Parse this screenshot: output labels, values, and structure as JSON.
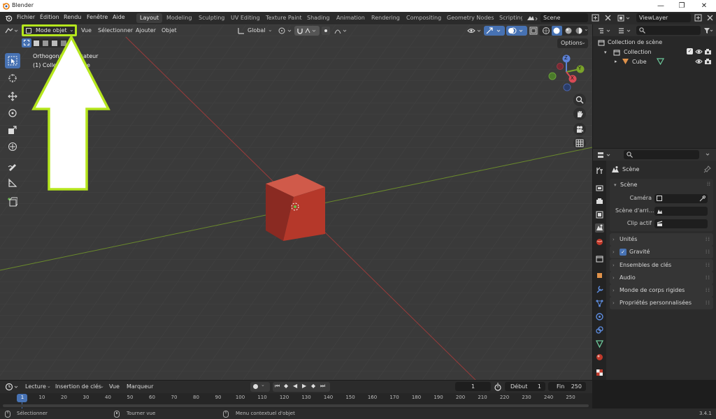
{
  "window": {
    "title": "Blender",
    "controls": {
      "minimize": "—",
      "maximize": "❐",
      "close": "✕"
    }
  },
  "menus": [
    "Fichier",
    "Édition",
    "Rendu",
    "Fenêtre",
    "Aide"
  ],
  "workspaces": [
    "Layout",
    "Modeling",
    "Sculpting",
    "UV Editing",
    "Texture Paint",
    "Shading",
    "Animation",
    "Rendering",
    "Compositing",
    "Geometry Nodes",
    "Scripting"
  ],
  "active_workspace": "Layout",
  "scene": {
    "name": "Scene",
    "view_layer": "ViewLayer"
  },
  "viewport": {
    "mode": "Mode objet",
    "menus": [
      "Vue",
      "Sélectionner",
      "Ajouter",
      "Objet"
    ],
    "transform_orientation": "Global",
    "options_label": "Options",
    "overlay_line1": "Orthogonale Utilisateur",
    "overlay_line2": "(1) Collection | Cube",
    "gizmo": {
      "z": "Z",
      "y": "Y",
      "x": "X"
    },
    "highlight_color": "#b5e61d",
    "cube_color": "#b5382a"
  },
  "outliner": {
    "root": "Collection de scène",
    "collection": "Collection",
    "object": "Cube",
    "search_placeholder": ""
  },
  "properties": {
    "title": "Scène",
    "section_title": "Scène",
    "camera_label": "Caméra",
    "background_label": "Scène d'arri...",
    "clip_label": "Clip actif",
    "panels": [
      "Unités",
      "Gravité",
      "Ensembles de clés",
      "Audio",
      "Monde de corps rigides",
      "Propriétés personnalisées"
    ]
  },
  "timeline": {
    "menus": [
      "Lecture",
      "Insertion de clés",
      "Vue",
      "Marqueur"
    ],
    "current_frame": "1",
    "start_label": "Début",
    "start": "1",
    "end_label": "Fin",
    "end": "250",
    "frames": [
      "1",
      "10",
      "20",
      "30",
      "40",
      "50",
      "60",
      "70",
      "80",
      "90",
      "100",
      "110",
      "120",
      "130",
      "140",
      "150",
      "160",
      "170",
      "180",
      "190",
      "200",
      "210",
      "220",
      "230",
      "240",
      "250"
    ]
  },
  "status": {
    "select": "Sélectionner",
    "rotate": "Tourner vue",
    "context": "Menu contextuel d'objet",
    "version": "3.4.1"
  }
}
